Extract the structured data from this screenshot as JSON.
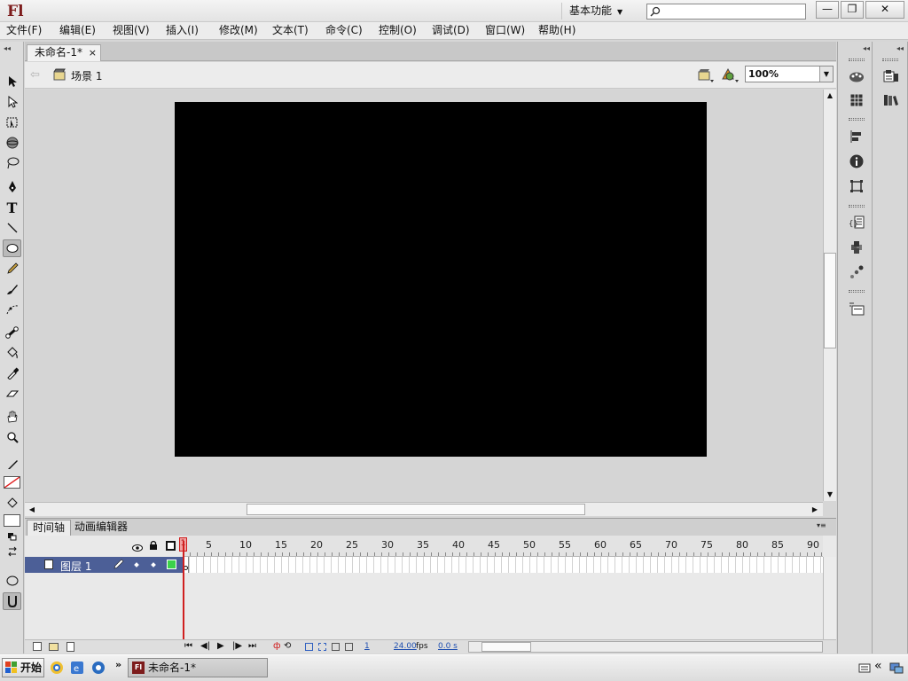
{
  "app": {
    "logo": "Fl",
    "workspace": "基本功能",
    "search_placeholder": ""
  },
  "window_buttons": {
    "minimize": "—",
    "restore": "❐",
    "close": "✕"
  },
  "menu": [
    "文件(F)",
    "编辑(E)",
    "视图(V)",
    "插入(I)",
    "修改(M)",
    "文本(T)",
    "命令(C)",
    "控制(O)",
    "调试(D)",
    "窗口(W)",
    "帮助(H)"
  ],
  "document": {
    "tab_title": "未命名-1*",
    "tab_close": "×",
    "scene": "场景 1",
    "zoom": "100%",
    "stage_color": "#000000"
  },
  "timeline": {
    "tabs": [
      "时间轴",
      "动画编辑器"
    ],
    "ruler": [
      "1",
      "5",
      "10",
      "15",
      "20",
      "25",
      "30",
      "35",
      "40",
      "45",
      "50",
      "55",
      "60",
      "65",
      "70",
      "75",
      "80",
      "85",
      "90"
    ],
    "layer": {
      "name": "图层 1"
    },
    "current_frame": "1",
    "fps": "24.00",
    "fps_unit": "fps",
    "time": "0.0 s"
  },
  "taskbar": {
    "start": "开始",
    "item": "未命名-1*"
  },
  "colors": {
    "brand": "#7d1c1c",
    "layer_selected": "#4c5f97",
    "playhead": "#d02020"
  }
}
